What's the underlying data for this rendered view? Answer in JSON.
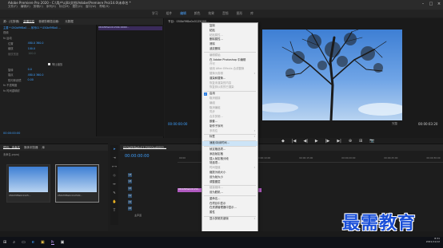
{
  "title_bar": {
    "title": "Adobe Premiere Pro 2020 - C:\\用户\\cjlb\\文档\\Adobe\\Premiere Pro\\14.0\\未命名 *",
    "menus": [
      "文件(F)",
      "编辑(E)",
      "剪辑(C)",
      "序列(S)",
      "标记(M)",
      "图形(G)",
      "窗口(W)",
      "帮助(H)"
    ]
  },
  "workspaces": {
    "tabs": [
      "学习",
      "组件",
      "编辑",
      "颜色",
      "效果",
      "音频",
      "图形",
      "库"
    ],
    "active": 2
  },
  "source_panel": {
    "tabs": [
      "源：(无剪辑)",
      "效果控件",
      "音频剪辑混合器：",
      "元数据"
    ],
    "active_tab": 1,
    "clip_header": "主要 * 050bf9f8a0 ... 序列01 * 050bf9f8a0 ...",
    "rows": [
      {
        "label": "视频",
        "value": ""
      },
      {
        "label": "fx 运动",
        "value": ""
      },
      {
        "label": "位置",
        "value": "480.0  360.0"
      },
      {
        "label": "缩放",
        "value": "100.0"
      },
      {
        "label": "缩放宽度",
        "value": "100.0"
      },
      {
        "label": "",
        "value": ""
      },
      {
        "label": "",
        "value": "等比缩放"
      },
      {
        "label": "旋转",
        "value": "0.0"
      },
      {
        "label": "锚点",
        "value": "480.0  360.0"
      },
      {
        "label": "防闪烁滤镜",
        "value": "0.00"
      },
      {
        "label": "fx 不透明度",
        "value": ""
      },
      {
        "label": "fx 时间重映射",
        "value": ""
      }
    ],
    "clip_label": "050bf9f8a0c012500cd0000...",
    "timecode": "00:00:00:00"
  },
  "program_monitor": {
    "title": "节目：050bf9f8a0c0125000...",
    "timecode_left": "00:00:00:00",
    "fit": "完整",
    "timecode_right": "00:00:03:20"
  },
  "transport": {
    "buttons": [
      "◆",
      "|◀",
      "◀|",
      "▶",
      "|▶",
      "▶|",
      "⊕",
      "⊞",
      "📷"
    ]
  },
  "project_panel": {
    "tabs": [
      "项目：未命名",
      "媒体浏览器",
      "库"
    ],
    "path": "未命名.prproj",
    "items": [
      {
        "name": "050bf9f8a0c0125..."
      },
      {
        "name": "050bf9f8a0c012500..."
      }
    ]
  },
  "timeline": {
    "tab": "050bf9f8a0c0125000cd0000...",
    "timecode": "00:00:00:00",
    "ruler": [
      "00:00",
      "00:00:05:00",
      "00:00:10:00",
      "00:00:15:00",
      "00:00:20:00",
      "00:00:25:00",
      "00:00:30:00",
      "00:00:35:00"
    ],
    "tracks": [
      "V3",
      "V2",
      "V1",
      "A1",
      "A2",
      "A3",
      "主声道"
    ],
    "clip": "050bf9f8a0c01250..."
  },
  "context_menu": {
    "items": [
      {
        "label": "复制",
        "state": "normal"
      },
      {
        "label": "粘贴",
        "state": "normal"
      },
      {
        "label": "粘贴属性...",
        "state": "disabled"
      },
      {
        "label": "删除属性...",
        "state": "normal"
      },
      {
        "label": "清除",
        "state": "normal"
      },
      {
        "label": "波纹删除",
        "state": "normal"
      },
      {
        "sep": true
      },
      {
        "label": "编辑原始",
        "state": "disabled"
      },
      {
        "label": "在 Adobe Photoshop 中编辑",
        "state": "normal"
      },
      {
        "label": "许可",
        "state": "disabled"
      },
      {
        "label": "使用 After Effects 合成替换",
        "state": "disabled"
      },
      {
        "label": "替换为剪辑",
        "state": "disabled",
        "sub": true
      },
      {
        "label": "渲染和替换...",
        "state": "normal"
      },
      {
        "label": "恢复未渲染的内容",
        "state": "disabled"
      },
      {
        "label": "恢复到以前的已渲染",
        "state": "disabled"
      },
      {
        "sep": true
      },
      {
        "label": "启用",
        "state": "normal",
        "checked": true
      },
      {
        "label": "取消链接",
        "state": "disabled"
      },
      {
        "label": "编组",
        "state": "disabled"
      },
      {
        "label": "取消编组",
        "state": "disabled"
      },
      {
        "label": "同步",
        "state": "disabled"
      },
      {
        "label": "合并剪辑...",
        "state": "disabled"
      },
      {
        "label": "嵌套...",
        "state": "normal"
      },
      {
        "label": "制作子序列",
        "state": "normal"
      },
      {
        "label": "多机位",
        "state": "disabled",
        "sub": true
      },
      {
        "sep": true
      },
      {
        "label": "标签",
        "state": "normal",
        "sub": true
      },
      {
        "sep": true
      },
      {
        "label": "速度/持续时间...",
        "state": "normal",
        "highlight": true
      },
      {
        "sep": true
      },
      {
        "label": "帧定格选项...",
        "state": "normal"
      },
      {
        "label": "添加帧定格",
        "state": "normal"
      },
      {
        "label": "插入帧定格分段",
        "state": "normal"
      },
      {
        "label": "场选项...",
        "state": "normal"
      },
      {
        "label": "时间插值",
        "state": "disabled",
        "sub": true
      },
      {
        "label": "缩放为帧大小",
        "state": "normal"
      },
      {
        "label": "设为帧大小",
        "state": "normal"
      },
      {
        "label": "调整图层",
        "state": "normal"
      },
      {
        "sep": true
      },
      {
        "label": "链接媒体...",
        "state": "disabled"
      },
      {
        "label": "设为脱机...",
        "state": "normal"
      },
      {
        "sep": true
      },
      {
        "label": "重命名...",
        "state": "normal"
      },
      {
        "label": "在项目中显示",
        "state": "normal"
      },
      {
        "label": "在资源管理器中显示...",
        "state": "normal"
      },
      {
        "label": "属性",
        "state": "normal"
      },
      {
        "sep": true
      },
      {
        "label": "显示剪辑关键帧",
        "state": "normal",
        "sub": true
      }
    ]
  },
  "watermark": "最需教育",
  "taskbar": {
    "icons": [
      "⊞",
      "⌕",
      "▭",
      "e",
      "▣",
      "Pr",
      "▣"
    ],
    "tray_time": "8:31",
    "tray_date": "2021/11/12"
  }
}
